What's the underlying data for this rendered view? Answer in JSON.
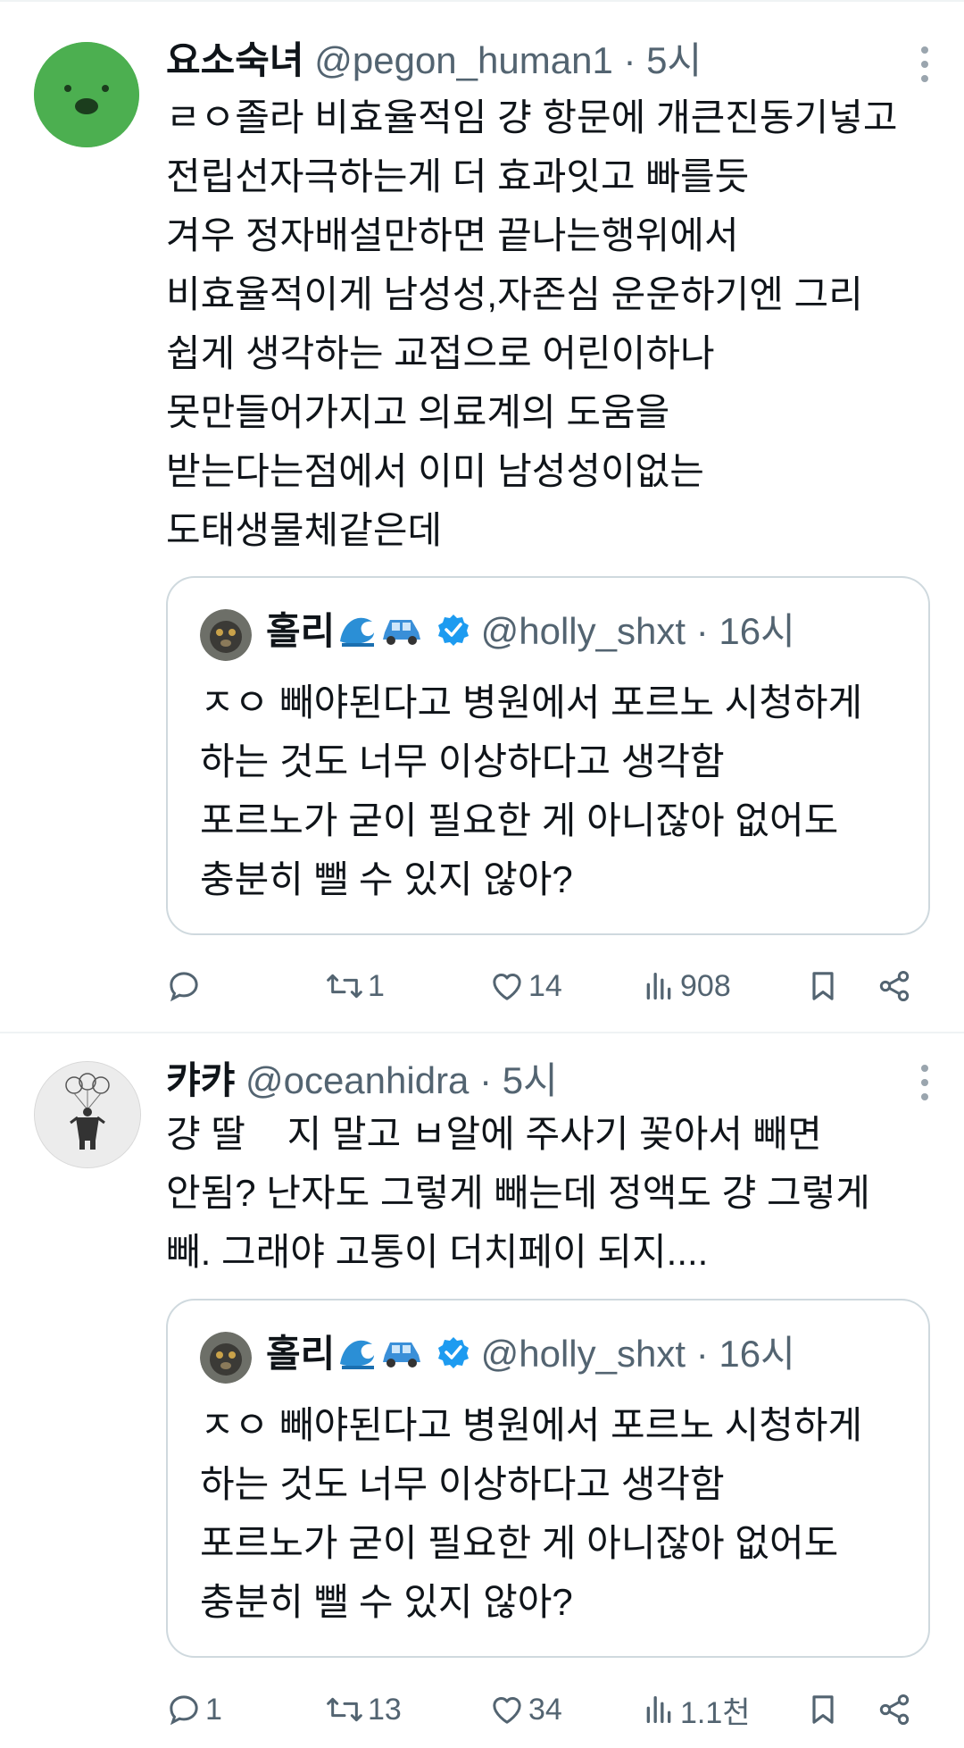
{
  "tweets": [
    {
      "author": {
        "display_name": "요소숙녀",
        "handle": "@pegon_human1",
        "time": "5시"
      },
      "separator": "·",
      "text_lines": [
        "ㄹㅇ졸라 비효율적임 걍 항문에 개큰진동기넣고",
        "전립선자극하는게 더 효과잇고 빠를듯",
        "겨우 정자배설만하면 끝나는행위에서",
        "비효율적이게 남성성,자존심 운운하기엔 그리",
        "쉽게 생각하는 교접으로 어린이하나",
        "못만들어가지고 의료계의 도움을",
        "받는다는점에서 이미 남성성이없는",
        "도태생물체같은데"
      ],
      "quote": {
        "display_name": "홀리",
        "handle": "@holly_shxt",
        "time": "16시",
        "text_lines": [
          "ㅈㅇ 빼야된다고 병원에서 포르노 시청하게",
          "하는 것도 너무 이상하다고 생각함",
          "포르노가 굳이 필요한 게 아니잖아 없어도",
          "충분히 뺄 수 있지 않아?"
        ]
      },
      "actions": {
        "replies": "",
        "retweets": "1",
        "likes": "14",
        "views": "908"
      }
    },
    {
      "author": {
        "display_name": "캬캬",
        "handle": "@oceanhidra",
        "time": "5시"
      },
      "separator": "·",
      "text_lines": [
        "걍 딸    지 말고 ㅂ알에 주사기 꽂아서 빼면",
        "안됨? 난자도 그렇게 빼는데 정액도 걍 그렇게",
        "빼. 그래야 고통이 더치페이 되지...."
      ],
      "quote": {
        "display_name": "홀리",
        "handle": "@holly_shxt",
        "time": "16시",
        "text_lines": [
          "ㅈㅇ 빼야된다고 병원에서 포르노 시청하게",
          "하는 것도 너무 이상하다고 생각함",
          "포르노가 굳이 필요한 게 아니잖아 없어도",
          "충분히 뺄 수 있지 않아?"
        ]
      },
      "actions": {
        "replies": "1",
        "retweets": "13",
        "likes": "34",
        "views": "1.1천"
      }
    }
  ],
  "colors": {
    "text_primary": "#0f1419",
    "text_secondary": "#536471",
    "border": "#cfd9de",
    "divider": "#eff3f4",
    "verified": "#1d9bf0",
    "avatar_green": "#4caf50"
  },
  "icons": {
    "reply": "reply-bubble-icon",
    "retweet": "retweet-arrows-icon",
    "like": "heart-icon",
    "views": "bar-chart-icon",
    "bookmark": "bookmark-icon",
    "share": "share-icon",
    "more": "more-vertical-icon",
    "verified": "verified-badge-icon",
    "wave": "wave-emoji-icon",
    "car": "car-emoji-icon"
  }
}
